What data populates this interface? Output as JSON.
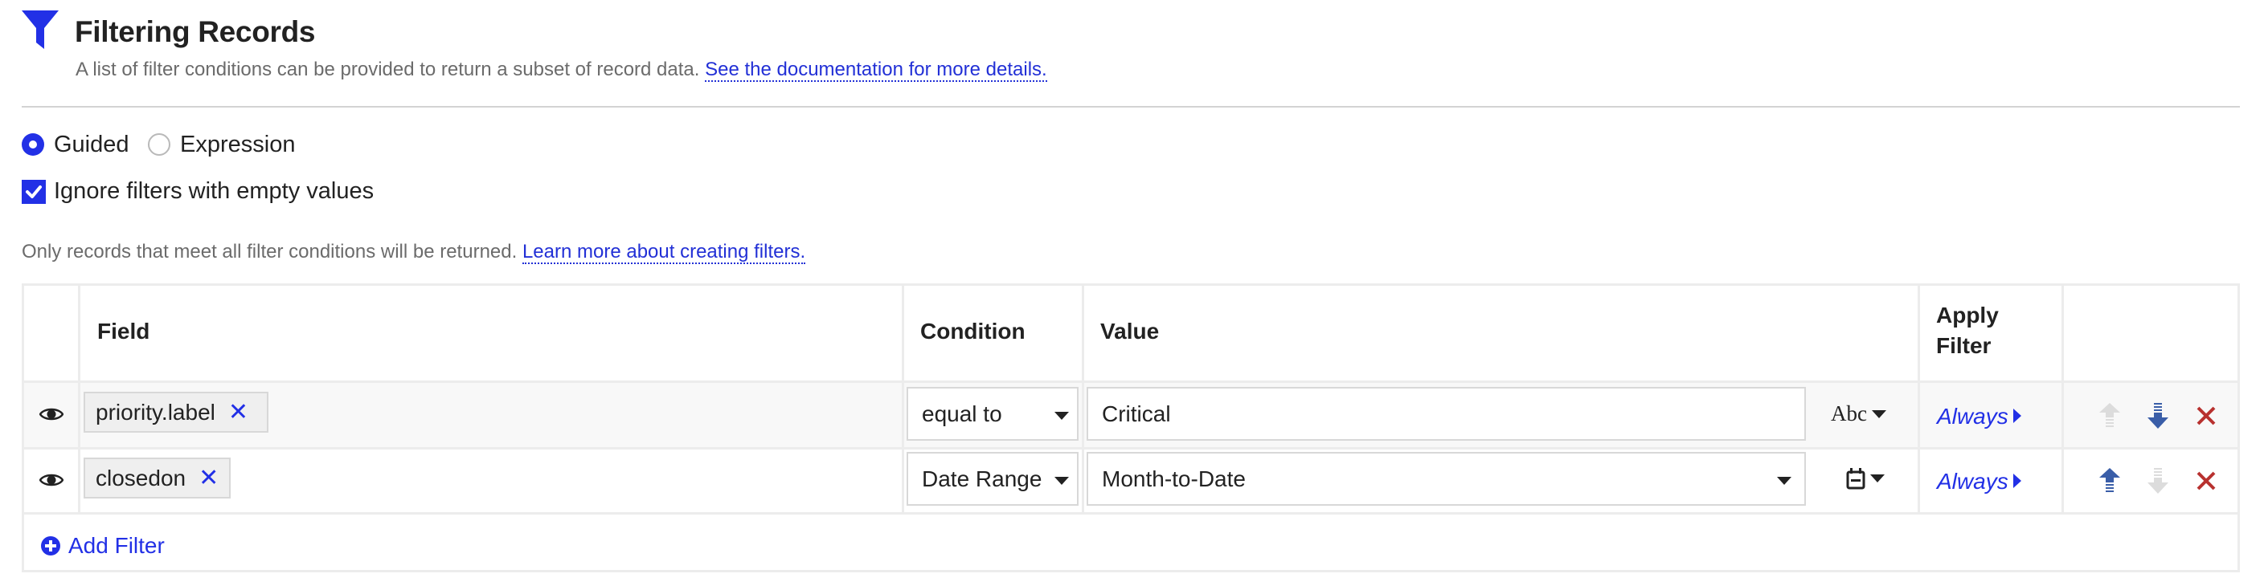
{
  "header": {
    "icon": "funnel-icon",
    "title": "Filtering Records",
    "description": "A list of filter conditions can be provided to return a subset of record data.",
    "doc_link": "See the documentation for more details."
  },
  "mode": {
    "options": [
      {
        "label": "Guided",
        "selected": true
      },
      {
        "label": "Expression",
        "selected": false
      }
    ]
  },
  "ignore_empty": {
    "label": "Ignore filters with empty values",
    "checked": true
  },
  "info": {
    "text": "Only records that meet all filter conditions will be returned.",
    "link": "Learn more about creating filters."
  },
  "table": {
    "columns": {
      "field": "Field",
      "condition": "Condition",
      "value": "Value",
      "apply_filter": "Apply Filter"
    },
    "rows": [
      {
        "visibility_icon": "eye-icon",
        "field": "priority.label",
        "condition": "equal to",
        "value": "Critical",
        "value_kind": "text-input",
        "value_type_label": "Abc",
        "value_type_icon": "text-type-icon",
        "apply_filter": "Always",
        "move_up_enabled": false,
        "move_down_enabled": true
      },
      {
        "visibility_icon": "eye-icon",
        "field": "closedon",
        "condition": "Date Range",
        "value": "Month-to-Date",
        "value_kind": "select",
        "value_type_label": "",
        "value_type_icon": "calendar-icon",
        "apply_filter": "Always",
        "move_up_enabled": true,
        "move_down_enabled": false
      }
    ],
    "add_filter_label": "Add Filter"
  },
  "colors": {
    "accent": "#2230e6",
    "link": "#2230d6",
    "move_arrow": "#3a5ea8",
    "move_arrow_disabled": "#dcdcdc",
    "delete": "#b8312f",
    "border": "#ececec",
    "row_alt_bg": "#f8f8f8"
  }
}
